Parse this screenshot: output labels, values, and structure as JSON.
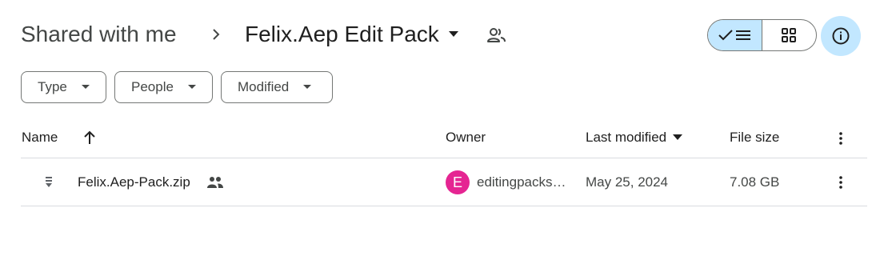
{
  "breadcrumb": {
    "root": "Shared with me",
    "current": "Felix.Aep Edit Pack"
  },
  "filters": {
    "type": "Type",
    "people": "People",
    "modified": "Modified"
  },
  "table": {
    "columns": {
      "name": "Name",
      "owner": "Owner",
      "last_modified": "Last modified",
      "file_size": "File size"
    },
    "rows": [
      {
        "name": "Felix.Aep-Pack.zip",
        "owner_initial": "E",
        "owner": "editingpacks…",
        "last_modified": "May 25, 2024",
        "file_size": "7.08 GB"
      }
    ]
  },
  "icons": {
    "sort": "arrow-up-icon",
    "file": "zip-file-icon",
    "shared": "people-icon",
    "info": "info-icon",
    "list_view": "list-view-icon",
    "grid_view": "grid-view-icon"
  },
  "colors": {
    "accent": "#c2e7ff",
    "avatar": "#e52592",
    "divider": "#dadce0"
  }
}
